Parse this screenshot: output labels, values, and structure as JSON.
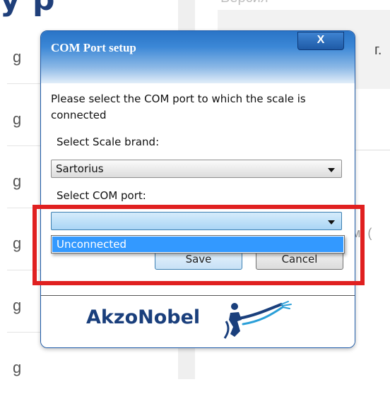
{
  "background": {
    "heading_fragment": "y   p",
    "right_label": "Версия",
    "panel_text": "г.",
    "partial_text": "ем: (",
    "row_units": [
      "g",
      "g",
      "g",
      "g",
      "g",
      "g"
    ]
  },
  "dialog": {
    "title": "COM Port setup",
    "close_label": "X",
    "prompt": "Please select the COM port to which the scale is connected",
    "brand_label": "Select Scale brand:",
    "brand_value": "Sartorius",
    "port_label": "Select COM port:",
    "port_value": "",
    "save_label": "Save",
    "cancel_label": "Cancel",
    "logo_text": "AkzoNobel"
  },
  "dropdown": {
    "options": [
      "Unconnected"
    ]
  },
  "colors": {
    "title_blue": "#2a74c6",
    "selection_blue": "#3399ff",
    "highlight_red": "#e02020",
    "logo_blue": "#1a3f7c"
  }
}
